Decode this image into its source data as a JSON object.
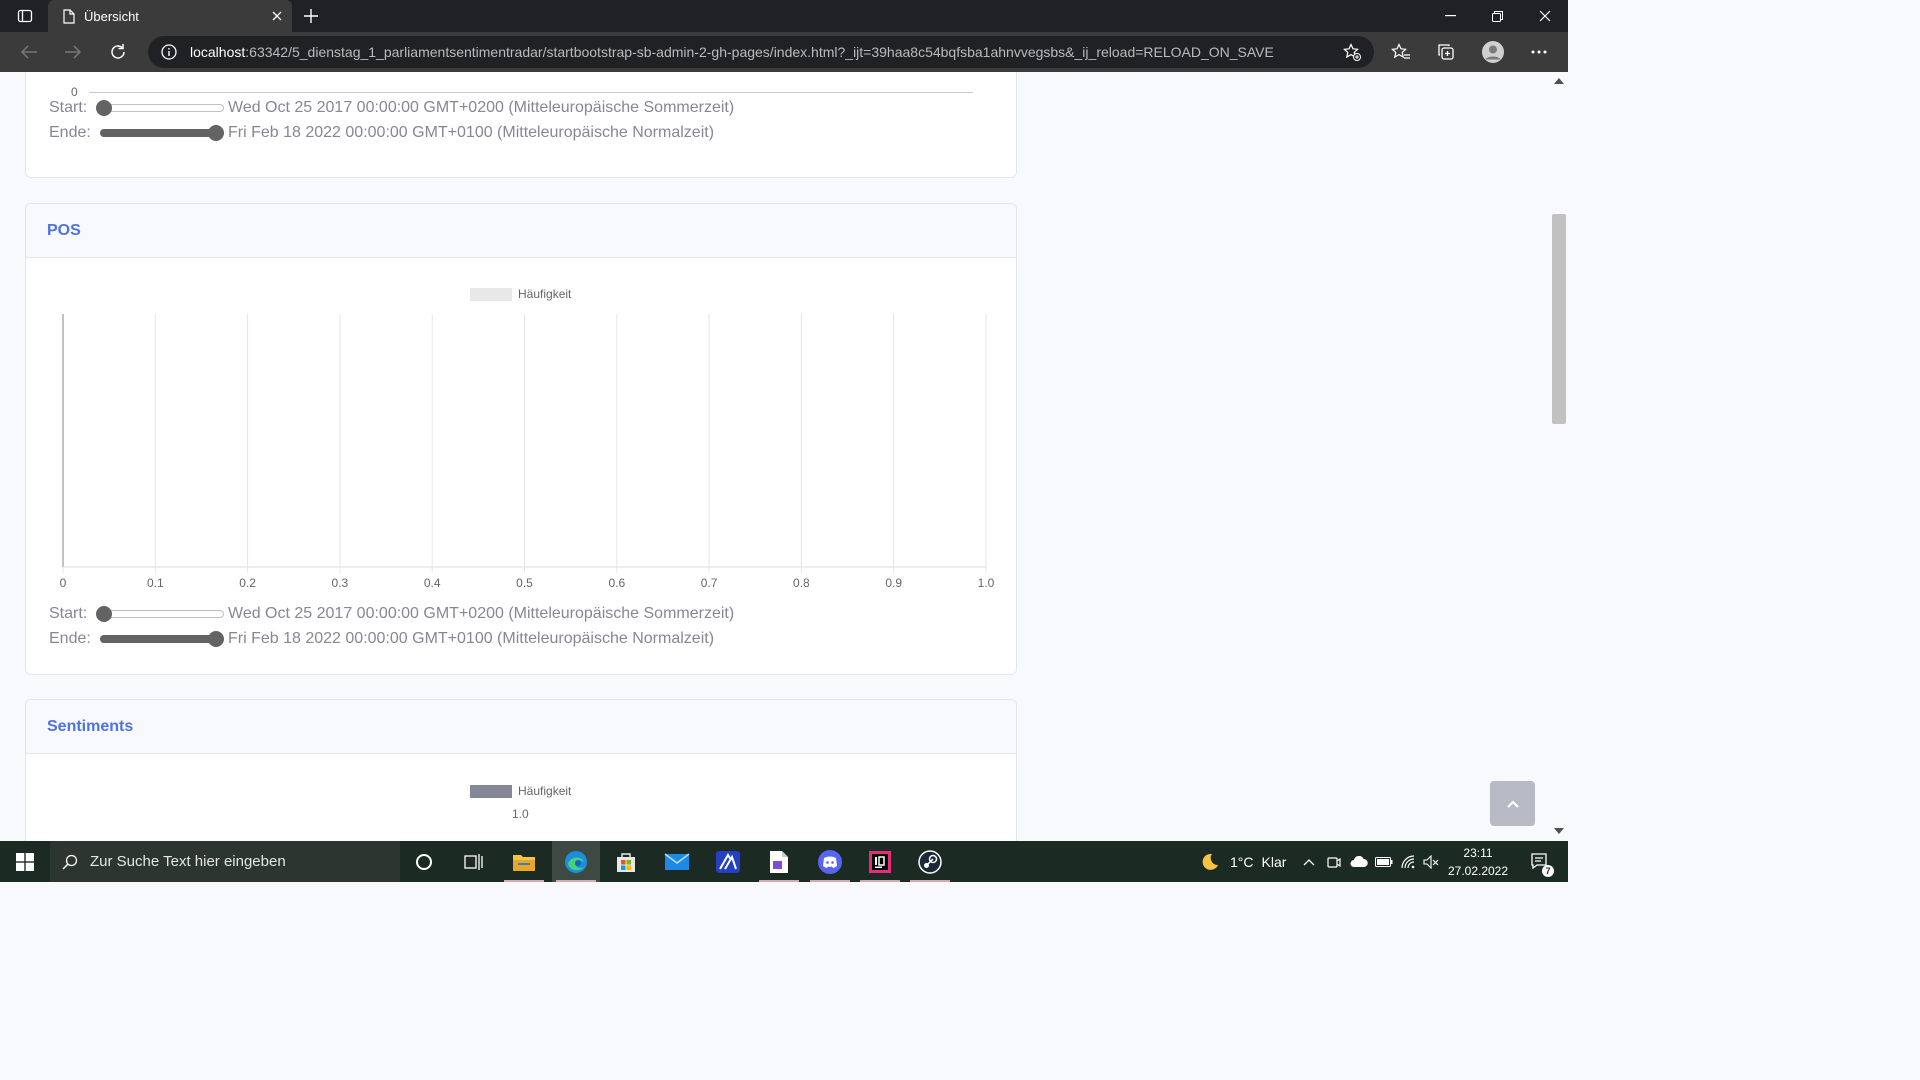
{
  "browser": {
    "tab_title": "Übersicht",
    "url_host": "localhost",
    "url_rest": ":63342/5_dienstag_1_parliamentsentimentradar/startbootstrap-sb-admin-2-gh-pages/index.html?_ijt=39haa8c54bqfsba1ahnvvegsbs&_ij_reload=RELOAD_ON_SAVE"
  },
  "cards": [
    {
      "partial_axis_zero": "0",
      "start_label": "Start:",
      "start_value": "Wed Oct 25 2017 00:00:00 GMT+0200 (Mitteleuropäische Sommerzeit)",
      "end_label": "Ende:",
      "end_value": "Fri Feb 18 2022 00:00:00 GMT+0100 (Mitteleuropäische Normalzeit)"
    },
    {
      "title": "POS",
      "legend": "Häufigkeit",
      "start_label": "Start:",
      "start_value": "Wed Oct 25 2017 00:00:00 GMT+0200 (Mitteleuropäische Sommerzeit)",
      "end_label": "Ende:",
      "end_value": "Fri Feb 18 2022 00:00:00 GMT+0100 (Mitteleuropäische Normalzeit)"
    },
    {
      "title": "Sentiments",
      "legend": "Häufigkeit",
      "axis_top": "1.0"
    }
  ],
  "slider_levels": {
    "start": 0,
    "end": 1
  },
  "chart_data": {
    "type": "bar",
    "title": "",
    "legend": [
      "Häufigkeit"
    ],
    "legend_position": "top",
    "x_ticks": [
      "0",
      "0.1",
      "0.2",
      "0.3",
      "0.4",
      "0.5",
      "0.6",
      "0.7",
      "0.8",
      "0.9",
      "1.0"
    ],
    "xlim": [
      0,
      1
    ],
    "grid": true,
    "series": [
      {
        "name": "Häufigkeit",
        "values": []
      }
    ]
  },
  "taskbar": {
    "search_placeholder": "Zur Suche Text hier eingeben",
    "weather_temp": "1°C",
    "weather_text": "Klar",
    "time": "23:11",
    "date": "27.02.2022",
    "notification_count": "7"
  },
  "colors": {
    "accent": "#4e73df",
    "muted_text": "#858796",
    "legend_pos": "#e8e8e8",
    "legend_sentiments": "#858796"
  }
}
